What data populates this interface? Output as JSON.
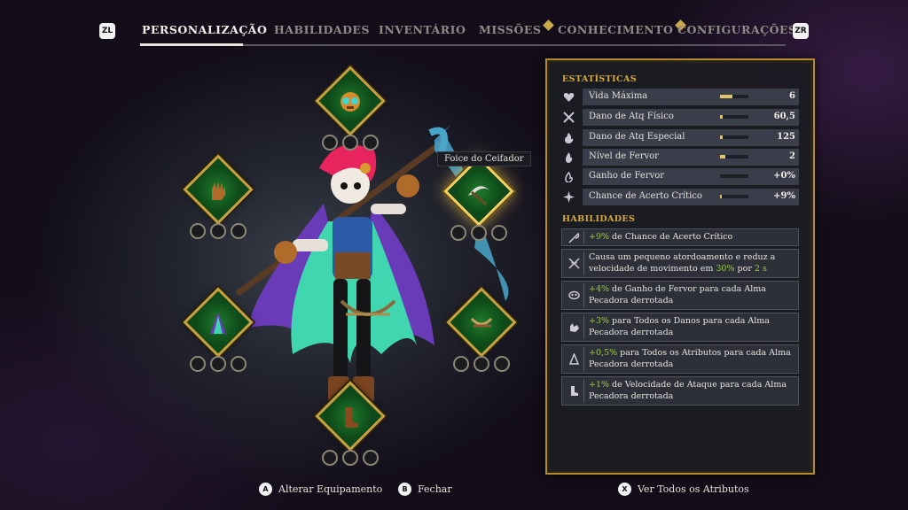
{
  "nav": {
    "left_shoulder": "ZL",
    "right_shoulder": "ZR",
    "tabs": [
      {
        "label": "PERSONALIZAÇÃO",
        "active": true,
        "badge": false
      },
      {
        "label": "HABILIDADES",
        "active": false,
        "badge": false
      },
      {
        "label": "INVENTÁRIO",
        "active": false,
        "badge": false
      },
      {
        "label": "MISSÕES",
        "active": false,
        "badge": true
      },
      {
        "label": "CONHECIMENTO",
        "active": false,
        "badge": true
      },
      {
        "label": "CONFIGURAÇÕES",
        "active": false,
        "badge": false
      }
    ]
  },
  "equipment": {
    "selected_item_tooltip": "Foice do Ceifador",
    "slots": [
      {
        "name": "mask",
        "icon": "mask-icon",
        "gems": 3
      },
      {
        "name": "gloves",
        "icon": "glove-icon",
        "gems": 3
      },
      {
        "name": "weapon",
        "icon": "scythe-icon",
        "gems": 3,
        "selected": true
      },
      {
        "name": "cloak",
        "icon": "cloak-icon",
        "gems": 3
      },
      {
        "name": "crossbow",
        "icon": "crossbow-icon",
        "gems": 3
      },
      {
        "name": "boots",
        "icon": "boots-icon",
        "gems": 3
      }
    ]
  },
  "stats": {
    "title": "ESTATÍSTICAS",
    "rows": [
      {
        "label": "Vida Máxima",
        "value": "6",
        "level": 0.45,
        "icon": "heart-icon"
      },
      {
        "label": "Dano de Atq Físico",
        "value": "60,5",
        "level": 0.1,
        "icon": "crossed-swords-icon"
      },
      {
        "label": "Dano de Atq Especial",
        "value": "125",
        "level": 0.1,
        "icon": "flame-icon"
      },
      {
        "label": "Nível de Fervor",
        "value": "2",
        "level": 0.2,
        "icon": "fervor-icon"
      },
      {
        "label": "Ganho de Fervor",
        "value": "+0%",
        "level": 0.0,
        "icon": "fervor-gain-icon"
      },
      {
        "label": "Chance de Acerto Crítico",
        "value": "+9%",
        "level": 0.05,
        "icon": "burst-icon"
      }
    ]
  },
  "abilities": {
    "title": "HABILIDADES",
    "items": [
      {
        "highlight": "+9%",
        "text": " de Chance de Acerto Crítico",
        "icon": "scythe-small-icon"
      },
      {
        "pre": "Causa um pequeno atordoamento e reduz a velocidade de movimento em ",
        "highlight": "30%",
        "mid": " por ",
        "highlight2": "2 s",
        "icon": "stun-icon"
      },
      {
        "highlight": "+4%",
        "text": " de Ganho de Fervor para cada Alma Pecadora derrotada",
        "icon": "mask-small-icon"
      },
      {
        "highlight": "+3%",
        "text": " para Todos os Danos para cada Alma Pecadora derrotada",
        "icon": "glove-small-icon"
      },
      {
        "highlight": "+0,5%",
        "text": " para Todos os Atributos para cada Alma Pecadora derrotada",
        "icon": "cloak-small-icon"
      },
      {
        "highlight": "+1%",
        "text": " de Velocidade de Ataque para cada Alma Pecadora derrotada",
        "icon": "boot-small-icon"
      }
    ]
  },
  "prompts": [
    {
      "button": "A",
      "label": "Alterar Equipamento"
    },
    {
      "button": "B",
      "label": "Fechar"
    },
    {
      "button": "X",
      "label": "Ver Todos os Atributos"
    }
  ],
  "colors": {
    "accent_gold": "#c7a040",
    "highlight_green": "#9bd13a",
    "slot_green": "#1f7a2c"
  }
}
